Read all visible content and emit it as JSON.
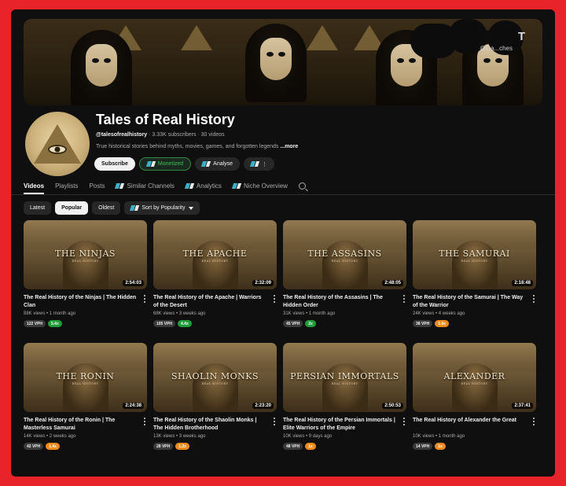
{
  "banner": {
    "title": "T",
    "handle": "@Da...ches"
  },
  "channel": {
    "name": "Tales of Real History",
    "handle": "@talesofrealhistory",
    "stats": "· 3.33K subscribers · 30 videos",
    "description": "True historical stories behind myths, movies, games, and forgotten legends",
    "more_label": "...more",
    "subscribe_label": "Subscribe",
    "monetized_label": "Monetized",
    "analyse_label": "Analyse"
  },
  "tabs": [
    {
      "label": "Videos",
      "active": true
    },
    {
      "label": "Playlists"
    },
    {
      "label": "Posts"
    },
    {
      "label": "Similar Channels",
      "icon": "vidiq-icon"
    },
    {
      "label": "Analytics",
      "icon": "vidiq-icon"
    },
    {
      "label": "Niche Overview",
      "icon": "vidiq-icon"
    }
  ],
  "filters": {
    "latest": "Latest",
    "popular": "Popular",
    "oldest": "Oldest",
    "sort": "Sort by Popularity"
  },
  "videos": [
    {
      "overlay": "THE NINJAS",
      "sub": "REAL HISTORY",
      "duration": "2:54:03",
      "title": "The Real History of the Ninjas | The Hidden Clan",
      "meta": "88K views • 1 month ago",
      "vph": "122 VPH",
      "score": "5.4x",
      "score_color": "green"
    },
    {
      "overlay": "THE APACHE",
      "sub": "REAL HISTORY",
      "duration": "2:32:09",
      "title": "The Real History of the Apache | Warriors of the Desert",
      "meta": "68K views • 3 weeks ago",
      "vph": "105 VPH",
      "score": "4.4x",
      "score_color": "green"
    },
    {
      "overlay": "THE ASSASINS",
      "sub": "REAL HISTORY",
      "duration": "2:48:05",
      "title": "The Real History of the Assasins | The Hidden Order",
      "meta": "31K views • 1 month ago",
      "vph": "45 VPH",
      "score": "2x",
      "score_color": "green"
    },
    {
      "overlay": "THE SAMURAI",
      "sub": "REAL HISTORY",
      "duration": "2:18:48",
      "title": "The Real History of the Samurai | The Way of the Warrior",
      "meta": "24K views • 4 weeks ago",
      "vph": "38 VPH",
      "score": "1.6x",
      "score_color": "orange"
    },
    {
      "overlay": "THE RONIN",
      "sub": "REAL HISTORY",
      "duration": "2:24:38",
      "title": "The Real History of the Ronin | The Masterless Samurai",
      "meta": "14K views • 2 weeks ago",
      "vph": "42 VPH",
      "score": "1.4x",
      "score_color": "orange"
    },
    {
      "overlay": "SHAOLIN MONKS",
      "sub": "REAL HISTORY",
      "duration": "2:23:20",
      "title": "The Real History of the Shaolin Monks | The Hidden Brotherhood",
      "meta": "13K views • 3 weeks ago",
      "vph": "28 VPH",
      "score": "1.2x",
      "score_color": "orange"
    },
    {
      "overlay": "PERSIAN IMMORTALS",
      "sub": "REAL HISTORY",
      "duration": "2:50:53",
      "title": "The Real History of the Persian Immortals | Elite Warriors of the Empire",
      "meta": "10K views • 9 days ago",
      "vph": "48 VPH",
      "score": "1x",
      "score_color": "orange"
    },
    {
      "overlay": "ALEXANDER",
      "sub": "REAL HISTORY",
      "duration": "2:37:41",
      "title": "The Real History of Alexander the Great",
      "meta": "10K views • 1 month ago",
      "vph": "14 VPH",
      "score": "1x",
      "score_color": "orange"
    }
  ]
}
